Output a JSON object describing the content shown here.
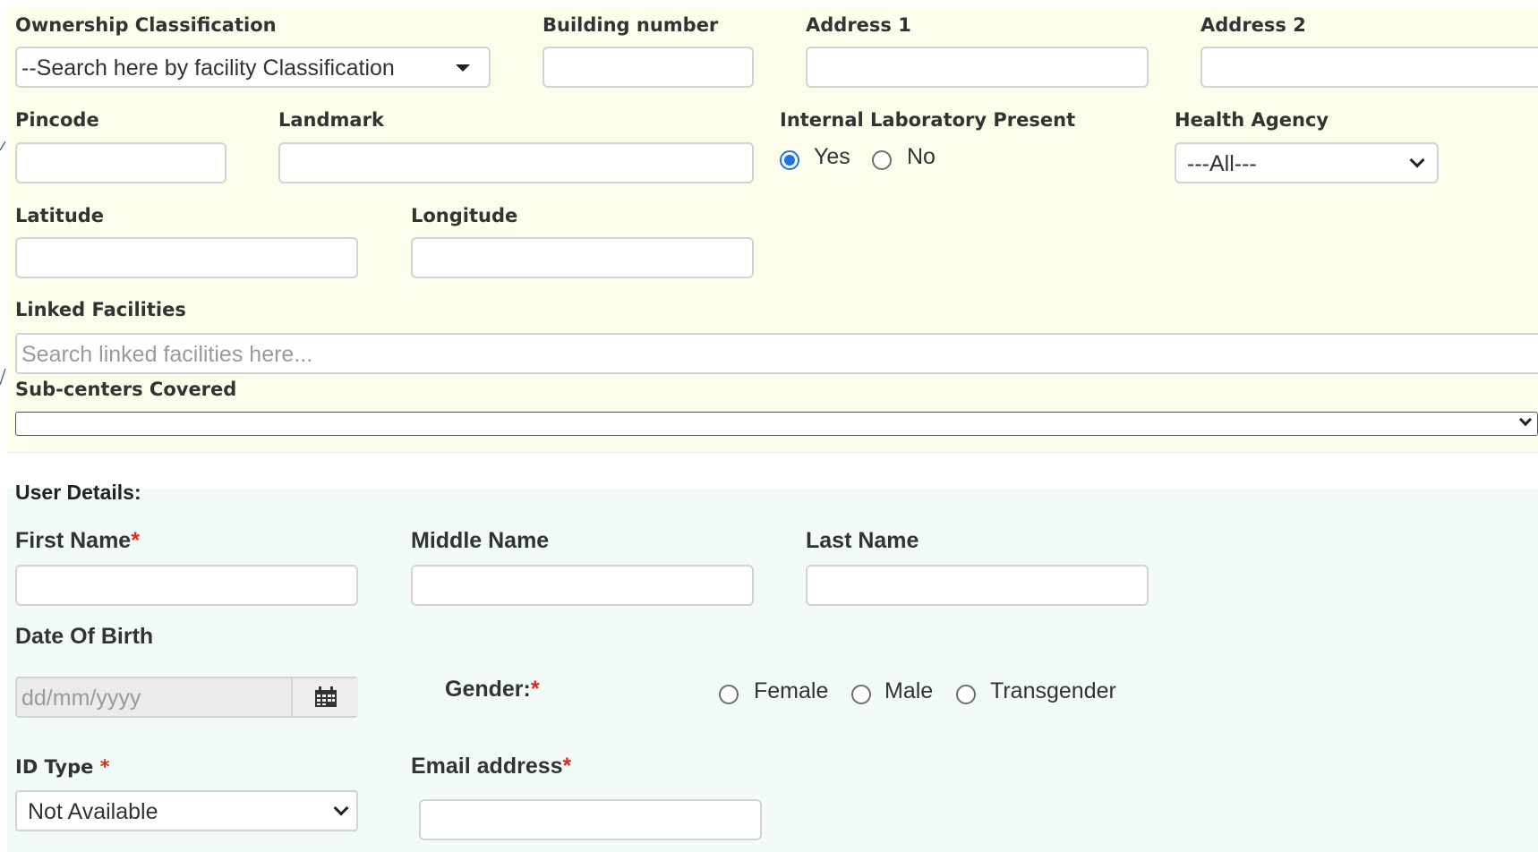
{
  "facility": {
    "ownership_classification": {
      "label": "Ownership Classification",
      "placeholder": "--Search here by facility Classification"
    },
    "building_number": {
      "label": "Building number",
      "value": ""
    },
    "address1": {
      "label": "Address 1",
      "value": ""
    },
    "address2": {
      "label": "Address 2",
      "value": ""
    },
    "pincode": {
      "label": "Pincode",
      "value": ""
    },
    "landmark": {
      "label": "Landmark",
      "value": ""
    },
    "internal_lab": {
      "label": "Internal Laboratory Present",
      "options": [
        "Yes",
        "No"
      ],
      "selected": "Yes"
    },
    "health_agency": {
      "label": "Health Agency",
      "selected": "---All---"
    },
    "latitude": {
      "label": "Latitude",
      "value": ""
    },
    "longitude": {
      "label": "Longitude",
      "value": ""
    },
    "linked_facilities": {
      "label": "Linked Facilities",
      "placeholder": "Search linked facilities here..."
    },
    "subcenters_covered": {
      "label": "Sub-centers Covered",
      "selected": ""
    }
  },
  "user": {
    "section_title": "User Details:",
    "first_name": {
      "label": "First Name",
      "required_mark": "*",
      "value": ""
    },
    "middle_name": {
      "label": "Middle Name",
      "value": ""
    },
    "last_name": {
      "label": "Last Name",
      "value": ""
    },
    "dob": {
      "label": "Date Of Birth",
      "placeholder": "dd/mm/yyyy"
    },
    "gender": {
      "label": "Gender:",
      "required_mark": "*",
      "options": [
        "Female",
        "Male",
        "Transgender"
      ],
      "selected": ""
    },
    "id_type": {
      "label": "ID Type ",
      "required_mark": "*",
      "selected": "Not Available"
    },
    "email": {
      "label": "Email address",
      "required_mark": "*",
      "value": ""
    }
  },
  "colors": {
    "facility_bg": "#fdfdeb",
    "user_bg": "#f2fbf7",
    "required": "#e0291c",
    "radio_checked": "#1a73e8"
  }
}
